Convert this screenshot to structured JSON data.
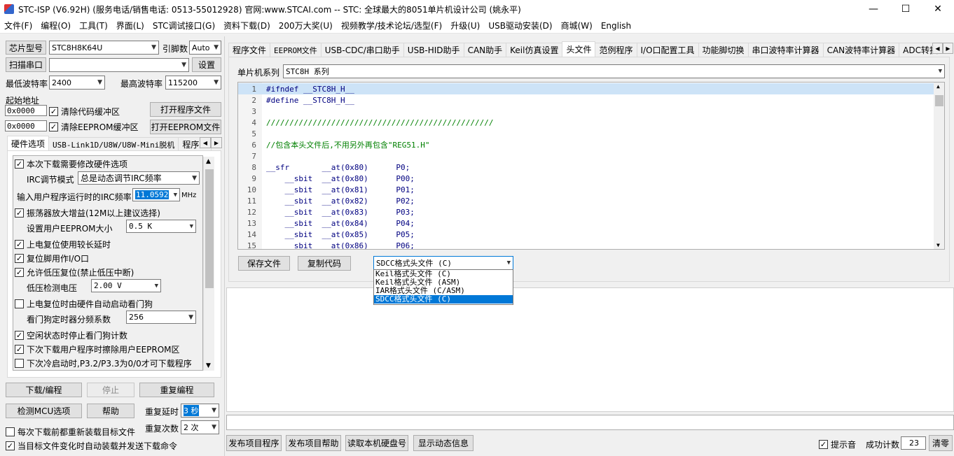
{
  "window": {
    "title": "STC-ISP (V6.92H) (服务电话/销售电话: 0513-55012928) 官网:www.STCAI.com  -- STC: 全球最大的8051单片机设计公司 (姚永平)",
    "minimize": "—",
    "maximize": "☐",
    "close": "✕"
  },
  "menu": [
    "文件(F)",
    "编程(O)",
    "工具(T)",
    "界面(L)",
    "STC调试接口(G)",
    "资料下载(D)",
    "200万大奖(U)",
    "视频教学/技术论坛/选型(F)",
    "升级(U)",
    "USB驱动安装(D)",
    "商城(W)",
    "English"
  ],
  "left": {
    "chip_type_label": "芯片型号",
    "chip_type": "STC8H8K64U",
    "pin_label": "引脚数",
    "pin_value": "Auto",
    "scan_port_button": "扫描串口",
    "port_value": "",
    "settings_button": "设置",
    "min_baud_label": "最低波特率",
    "min_baud": "2400",
    "max_baud_label": "最高波特率",
    "max_baud": "115200",
    "start_addr_label": "起始地址",
    "addr1": "0x0000",
    "clear_code_buffer": "清除代码缓冲区",
    "open_program_file": "打开程序文件",
    "addr2": "0x0000",
    "clear_eeprom_buffer": "清除EEPROM缓冲区",
    "open_eeprom_file": "打开EEPROM文件",
    "tabs": [
      "硬件选项",
      "USB-Link1D/U8W/U8W-Mini脱机",
      "程序加"
    ],
    "options": {
      "modify_hw": "本次下载需要修改硬件选项",
      "irc_mode_label": "IRC调节模式",
      "irc_mode": "总是动态调节IRC频率",
      "irc_freq_label": "输入用户程序运行时的IRC频率",
      "irc_freq": "11.0592",
      "irc_unit": "MHz",
      "osc_gain": "振荡器放大增益(12M以上建议选择)",
      "eeprom_size_label": "设置用户EEPROM大小",
      "eeprom_size": "0.5 K",
      "long_delay": "上电复位使用较长延时",
      "reset_io": "复位脚用作I/O口",
      "low_volt_reset": "允许低压复位(禁止低压中断)",
      "low_volt_label": "低压检测电压",
      "low_volt": "2.00 V",
      "wdt_auto": "上电复位时由硬件自动启动看门狗",
      "wdt_div_label": "看门狗定时器分频系数",
      "wdt_div": "256",
      "idle_stop_wdt": "空闲状态时停止看门狗计数",
      "erase_eeprom": "下次下载用户程序时擦除用户EEPROM区",
      "cold_boot": "下次冷启动时,P3.2/P3.3为0/0才可下载程序"
    },
    "download_button": "下载/编程",
    "stop_button": "停止",
    "reprogram_button": "重复编程",
    "detect_mcu_button": "检测MCU选项",
    "help_button": "帮助",
    "repeat_delay_label": "重复延时",
    "repeat_delay": "3 秒",
    "repeat_count_label": "重复次数",
    "repeat_count": "2 次",
    "reload_before": "每次下载前都重新装载目标文件",
    "auto_reload": "当目标文件变化时自动装载并发送下载命令"
  },
  "right": {
    "tabs": [
      "程序文件",
      "EEPROM文件",
      "USB-CDC/串口助手",
      "USB-HID助手",
      "CAN助手",
      "Keil仿真设置",
      "头文件",
      "范例程序",
      "I/O口配置工具",
      "功能脚切换",
      "串口波特率计算器",
      "CAN波特率计算器",
      "ADC转换速度"
    ],
    "mcu_series_label": "单片机系列",
    "mcu_series": "STC8H 系列",
    "code": [
      {
        "n": "1",
        "t": "#ifndef __STC8H_H__"
      },
      {
        "n": "2",
        "t": "#define __STC8H_H__"
      },
      {
        "n": "3",
        "t": ""
      },
      {
        "n": "4",
        "t": "/////////////////////////////////////////////////"
      },
      {
        "n": "5",
        "t": ""
      },
      {
        "n": "6",
        "t": "//包含本头文件后,不用另外再包含\"REG51.H\""
      },
      {
        "n": "7",
        "t": ""
      },
      {
        "n": "8",
        "t": "__sfr       __at(0x80)      P0;"
      },
      {
        "n": "9",
        "t": "    __sbit  __at(0x80)      P00;"
      },
      {
        "n": "10",
        "t": "    __sbit  __at(0x81)      P01;"
      },
      {
        "n": "11",
        "t": "    __sbit  __at(0x82)      P02;"
      },
      {
        "n": "12",
        "t": "    __sbit  __at(0x83)      P03;"
      },
      {
        "n": "13",
        "t": "    __sbit  __at(0x84)      P04;"
      },
      {
        "n": "14",
        "t": "    __sbit  __at(0x85)      P05;"
      },
      {
        "n": "15",
        "t": "    __sbit  __at(0x86)      P06;"
      }
    ],
    "save_file_button": "保存文件",
    "copy_code_button": "复制代码",
    "format_selected": "SDCC格式头文件 (C)",
    "format_options": [
      "Keil格式头文件 (C)",
      "Keil格式头文件 (ASM)",
      "IAR格式头文件 (C/ASM)",
      "SDCC格式头文件 (C)"
    ],
    "publish_program_button": "发布项目程序",
    "publish_help_button": "发布项目帮助",
    "read_disk_button": "读取本机硬盘号",
    "show_dynamic_button": "显示动态信息",
    "sound_label": "提示音",
    "success_count_label": "成功计数",
    "success_count": "23",
    "clear_button": "清零"
  }
}
